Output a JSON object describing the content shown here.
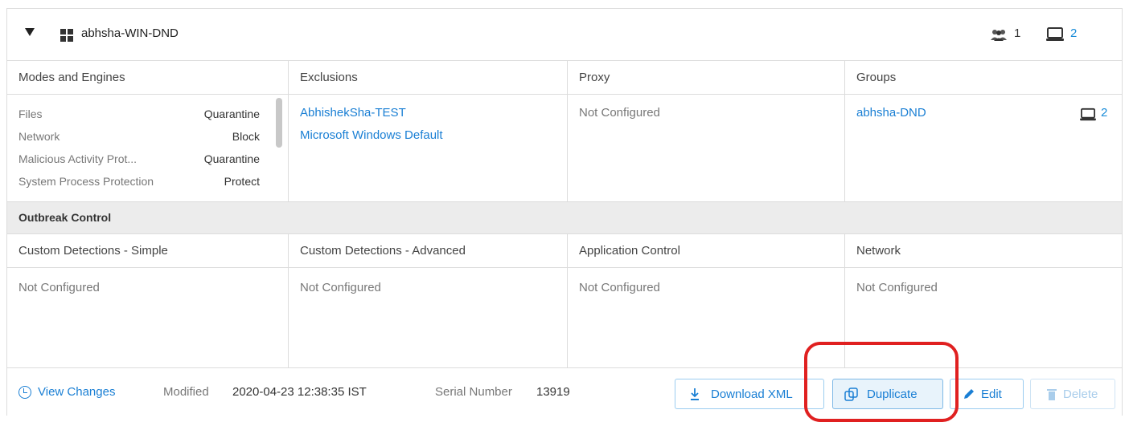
{
  "header": {
    "title": "abhsha-WIN-DND",
    "users_count": "1",
    "computers_count": "2"
  },
  "table1": {
    "columns": [
      "Modes and Engines",
      "Exclusions",
      "Proxy",
      "Groups"
    ],
    "modes": [
      {
        "label": "Files",
        "value": "Quarantine"
      },
      {
        "label": "Network",
        "value": "Block"
      },
      {
        "label": "Malicious Activity Prot...",
        "value": "Quarantine"
      },
      {
        "label": "System Process Protection",
        "value": "Protect"
      }
    ],
    "exclusions": [
      "AbhishekSha-TEST",
      "Microsoft Windows Default"
    ],
    "proxy": "Not Configured",
    "group": {
      "name": "abhsha-DND",
      "count": "2"
    }
  },
  "outbreak": {
    "title": "Outbreak Control",
    "columns": [
      "Custom Detections - Simple",
      "Custom Detections - Advanced",
      "Application Control",
      "Network"
    ],
    "values": [
      "Not Configured",
      "Not Configured",
      "Not Configured",
      "Not Configured"
    ]
  },
  "footer": {
    "view_changes": "View Changes",
    "modified_label": "Modified",
    "modified_value": "2020-04-23 12:38:35 IST",
    "serial_label": "Serial Number",
    "serial_value": "13919",
    "buttons": {
      "download": "Download XML",
      "duplicate": "Duplicate",
      "edit": "Edit",
      "delete": "Delete"
    }
  }
}
